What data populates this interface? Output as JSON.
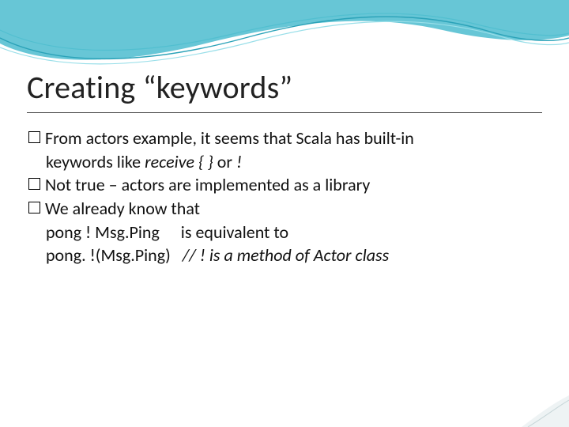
{
  "title": "Creating “keywords”",
  "bullets": [
    {
      "text_a": "From actors example, it seems that Scala has built-in",
      "text_b": "keywords like ",
      "italic_a": "receive { }",
      "text_c": " or ",
      "italic_b": "!"
    },
    {
      "text": "Not true – actors are implemented as a library"
    },
    {
      "text": "We already know that",
      "sub_a": "pong ! Msg.Ping  is equivalent to",
      "sub_b": "pong. !(Msg.Ping)",
      "sub_b_comment": "// ! is a method of Actor class"
    }
  ]
}
